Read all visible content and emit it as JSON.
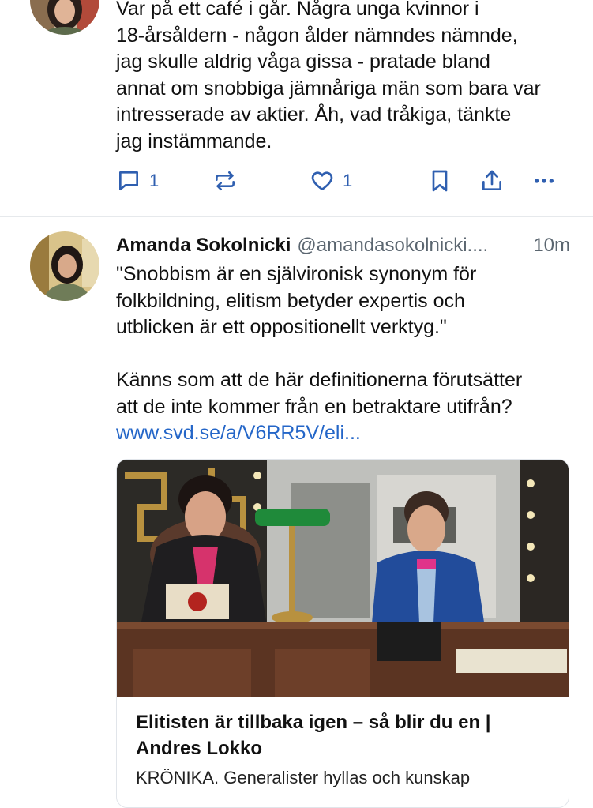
{
  "tweet1": {
    "text": "Var på ett café i går. Några unga kvinnor i\n18-årsåldern - någon ålder nämndes nämnde,\njag skulle aldrig våga gissa - pratade bland\nannat om snobbiga jämnåriga män som bara var\nintresserade av aktier. Åh, vad tråkiga, tänkte\njag instämmande.",
    "reply_count": "1",
    "like_count": "1",
    "icons": {
      "reply": "reply-icon",
      "repost": "repost-icon",
      "like": "heart-icon",
      "bookmark": "bookmark-icon",
      "share": "share-icon",
      "more": "more-icon"
    }
  },
  "tweet2": {
    "author": "Amanda Sokolnicki",
    "handle": "@amandasokolnicki....",
    "time": "10m",
    "text": "\"Snobbism är en självironisk synonym för\nfolkbildning, elitism betyder expertis och\nutblicken är ett oppositionellt verktyg.\"\n\nKänns som att de här definitionerna förutsätter\natt de inte kommer från en betraktare utifrån?",
    "link": "www.svd.se/a/V6RR5V/eli...",
    "card": {
      "title": "Elitisten är tillbaka igen – så blir du en | Andres Lokko",
      "description": "KRÖNIKA. Generalister hyllas och kunskap"
    }
  },
  "colors": {
    "accent": "#2f5fb0",
    "link": "#2466c8",
    "muted": "#5b6670",
    "divider": "#e6e9ec"
  }
}
